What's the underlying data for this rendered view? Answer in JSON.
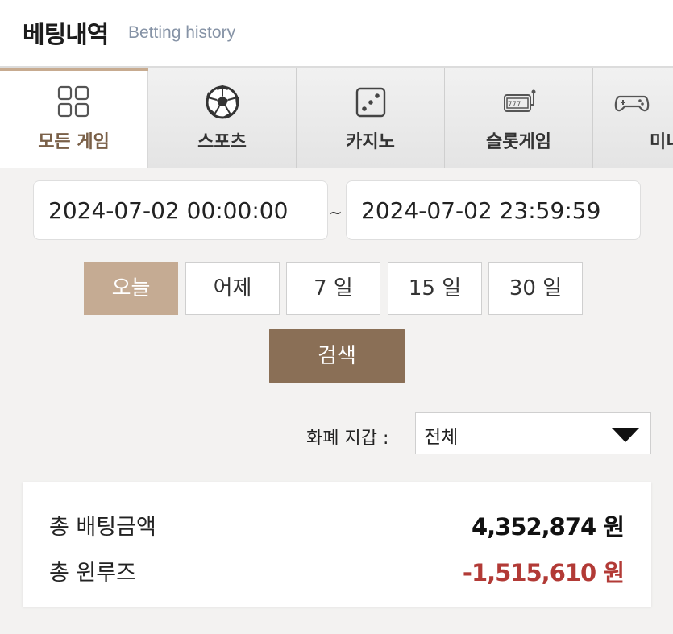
{
  "header": {
    "title": "베팅내역",
    "subtitle": "Betting history"
  },
  "tabs": [
    {
      "label": "모든 게임",
      "icon": "grid-icon",
      "active": true
    },
    {
      "label": "스포츠",
      "icon": "soccer-ball-icon",
      "active": false
    },
    {
      "label": "카지노",
      "icon": "dice-icon",
      "active": false
    },
    {
      "label": "슬롯게임",
      "icon": "slot-machine-icon",
      "active": false
    },
    {
      "label": "미니",
      "icon": "gamepad-icon",
      "active": false
    }
  ],
  "date_range": {
    "start": "2024-07-02 00:00:00",
    "separator": "~",
    "end": "2024-07-02 23:59:59"
  },
  "quick_ranges": [
    {
      "label": "오늘",
      "selected": true
    },
    {
      "label": "어제",
      "selected": false
    },
    {
      "label": "7 일",
      "selected": false
    },
    {
      "label": "15 일",
      "selected": false
    },
    {
      "label": "30 일",
      "selected": false
    }
  ],
  "search_button": "검색",
  "currency_filter": {
    "label": "화폐 지갑 :",
    "value": "전체"
  },
  "summary": {
    "total_bet_label": "총 배팅금액",
    "total_bet_value": "4,352,874 원",
    "total_winloss_label": "총 윈루즈",
    "total_winloss_value": "-1,515,610 원"
  },
  "colors": {
    "accent": "#c5ab93",
    "search": "#8a6f56",
    "negative": "#b23a36",
    "tab_active_bar": "#c7ab90"
  }
}
